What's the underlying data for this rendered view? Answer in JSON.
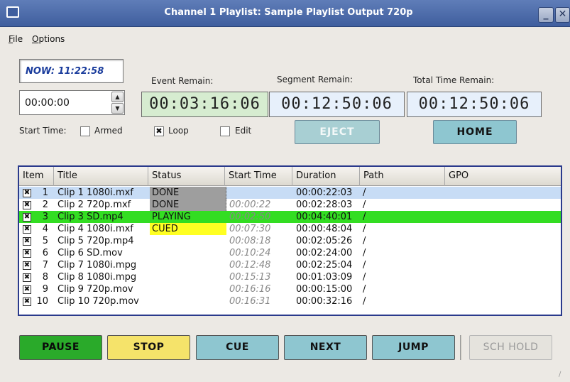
{
  "window": {
    "title": "Channel  1 Playlist:  Sample Playlist   Output 720p",
    "minimize_label": "_",
    "close_label": "✕"
  },
  "menu": {
    "file": "ile",
    "file_key": "F",
    "options": "ptions",
    "options_key": "O"
  },
  "clock": {
    "now": "NOW: 11:22:58"
  },
  "start_time": {
    "value": "00:00:00",
    "label": "Start Time:",
    "armed_label": "Armed"
  },
  "options": {
    "loop_label": "Loop",
    "loop_checked": true,
    "edit_label": "Edit"
  },
  "remain": {
    "event_label": "Event Remain:",
    "event_value": "00:03:16:06",
    "segment_label": "Segment Remain:",
    "segment_value": "00:12:50:06",
    "total_label": "Total Time Remain:",
    "total_value": "00:12:50:06"
  },
  "buttons": {
    "eject": "EJECT",
    "home": "HOME",
    "pause": "PAUSE",
    "stop": "STOP",
    "cue": "CUE",
    "next": "NEXT",
    "jump": "JUMP",
    "sch_hold": "SCH HOLD"
  },
  "table": {
    "columns": [
      "Item",
      "Title",
      "Status",
      "Start Time",
      "Duration",
      "Path",
      "GPO"
    ],
    "rows": [
      {
        "item": "1",
        "title": "Clip 1 1080i.mxf",
        "status": "DONE",
        "start": "",
        "duration": "00:00:22:03",
        "path": "/"
      },
      {
        "item": "2",
        "title": "Clip 2 720p.mxf",
        "status": "DONE",
        "start": "00:00:22",
        "duration": "00:02:28:03",
        "path": "/"
      },
      {
        "item": "3",
        "title": "Clip 3 SD.mp4",
        "status": "PLAYING",
        "start": "00:02:50",
        "duration": "00:04:40:01",
        "path": "/"
      },
      {
        "item": "4",
        "title": "Clip 4 1080i.mxf",
        "status": "CUED",
        "start": "00:07:30",
        "duration": "00:00:48:04",
        "path": "/"
      },
      {
        "item": "5",
        "title": "Clip 5 720p.mp4",
        "status": "",
        "start": "00:08:18",
        "duration": "00:02:05:26",
        "path": "/"
      },
      {
        "item": "6",
        "title": "Clip 6 SD.mov",
        "status": "",
        "start": "00:10:24",
        "duration": "00:02:24:00",
        "path": "/"
      },
      {
        "item": "7",
        "title": "Clip 7 1080i.mpg",
        "status": "",
        "start": "00:12:48",
        "duration": "00:02:25:04",
        "path": "/"
      },
      {
        "item": "8",
        "title": "Clip 8 1080i.mpg",
        "status": "",
        "start": "00:15:13",
        "duration": "00:01:03:09",
        "path": "/"
      },
      {
        "item": "9",
        "title": "Clip 9 720p.mov",
        "status": "",
        "start": "00:16:16",
        "duration": "00:00:15:00",
        "path": "/"
      },
      {
        "item": "10",
        "title": "Clip 10 720p.mov",
        "status": "",
        "start": "00:16:31",
        "duration": "00:00:32:16",
        "path": "/"
      }
    ]
  },
  "colors": {
    "playing_row": "#33dd22",
    "done_status": "#9e9e9e",
    "cued_status": "#ffff22",
    "selected_row": "#c7dcf5",
    "pause_button": "#2aaa2a",
    "stop_button": "#f5e36a",
    "action_button": "#8ec6d0"
  }
}
